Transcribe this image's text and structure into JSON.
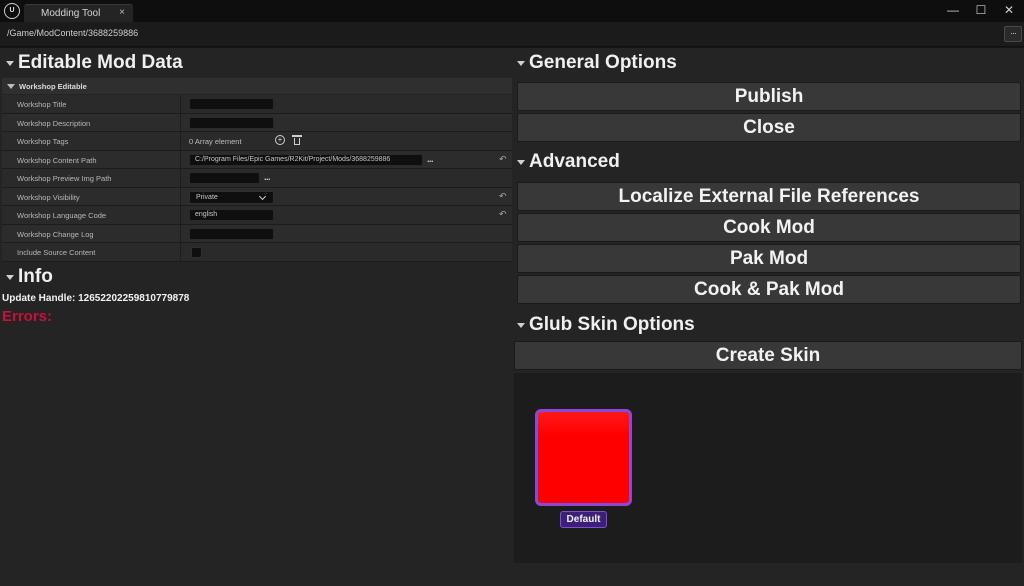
{
  "window": {
    "tab_title": "Modding Tool",
    "tab_close": "×",
    "minimize": "—",
    "maximize": "☐",
    "close": "✕"
  },
  "pathbar": {
    "path": "/Game/ModContent/3688259886",
    "menu": "···"
  },
  "editable": {
    "title": "Editable Mod Data",
    "category": "Workshop Editable",
    "rows": [
      {
        "label": "Workshop Title",
        "value": ""
      },
      {
        "label": "Workshop Description",
        "value": ""
      },
      {
        "label": "Workshop Tags",
        "value": "0 Array element"
      },
      {
        "label": "Workshop Content Path",
        "value": "C:/Program Files/Epic Games/R2Kit/Project/Mods/3688259886"
      },
      {
        "label": "Workshop Preview Img Path",
        "value": ""
      },
      {
        "label": "Workshop Visibility",
        "value": "Private"
      },
      {
        "label": "Workshop Language Code",
        "value": "english"
      },
      {
        "label": "Workshop Change Log",
        "value": ""
      },
      {
        "label": "Include Source Content",
        "value": false
      }
    ],
    "browse_label": "...",
    "reset_icon": "↶"
  },
  "info": {
    "title": "Info",
    "update_handle": "Update Handle: 1265220225981077987­8",
    "errors": "Errors:"
  },
  "general": {
    "title": "General Options",
    "publish": "Publish",
    "close": "Close"
  },
  "advanced": {
    "title": "Advanced",
    "localize": "Localize External File References",
    "cook": "Cook Mod",
    "pak": "Pak Mod",
    "cook_pak": "Cook & Pak Mod"
  },
  "skin": {
    "title": "Glub Skin Options",
    "create": "Create Skin",
    "swatch_label": "Default",
    "swatch_color": "#ff0000",
    "border_color": "#8b48d6"
  }
}
